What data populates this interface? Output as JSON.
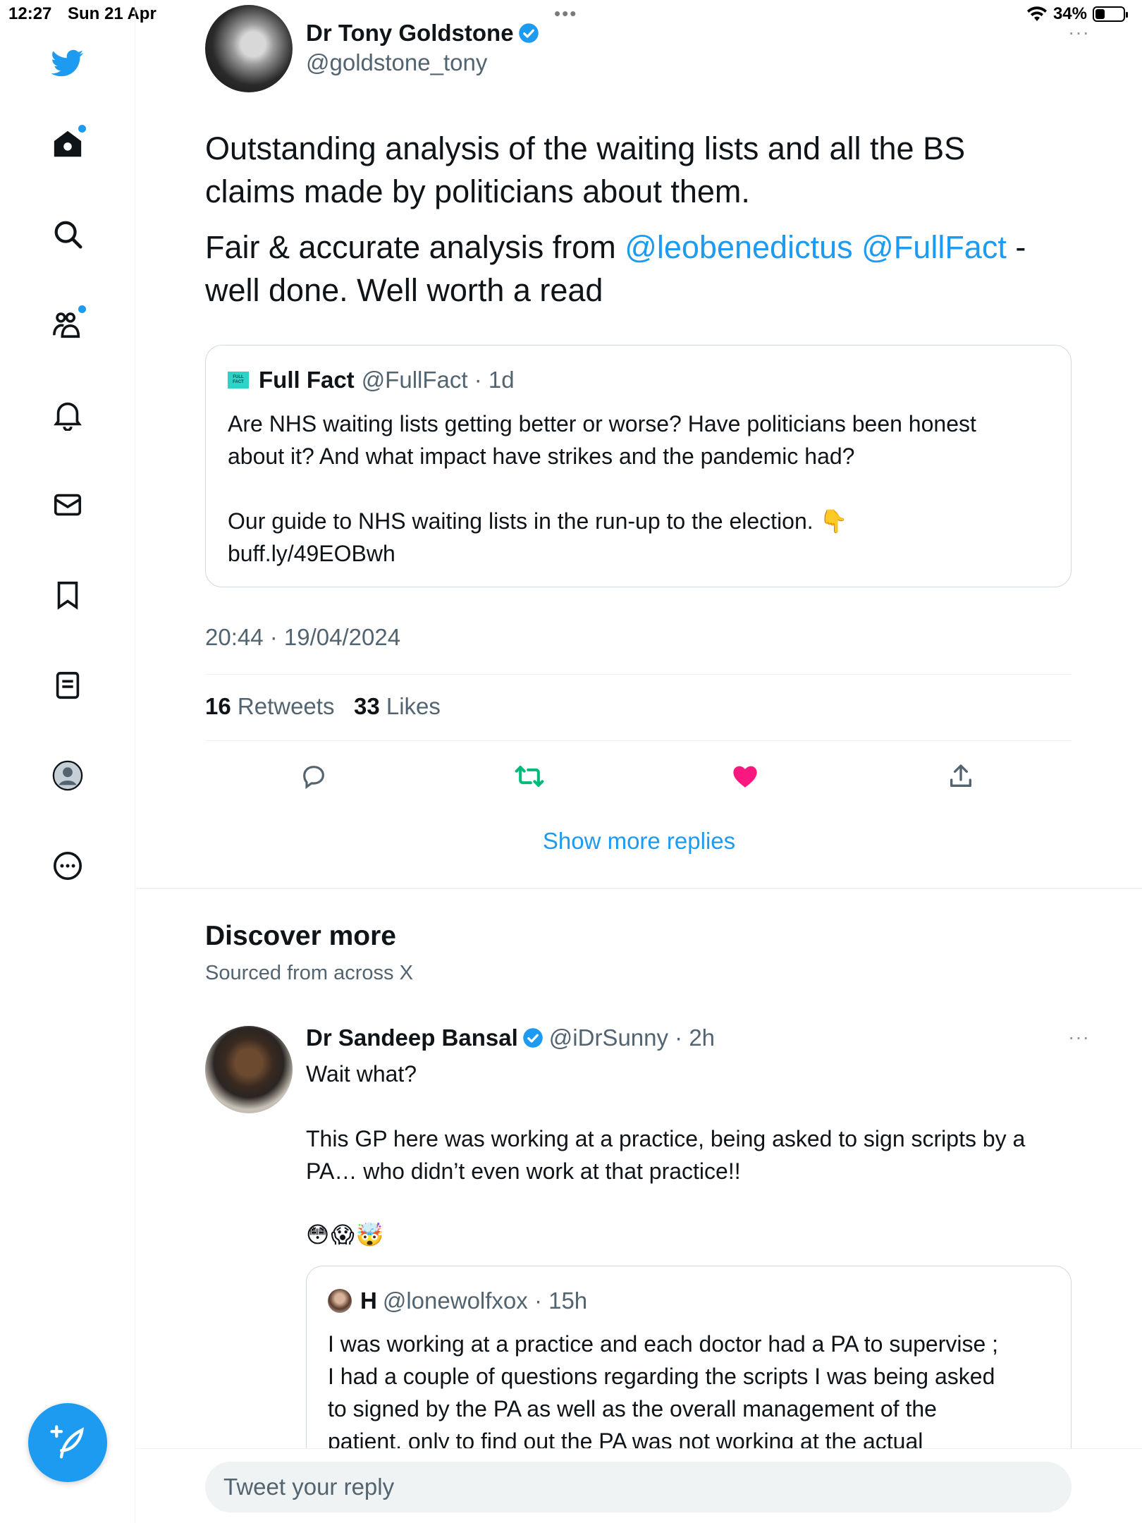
{
  "status_bar": {
    "time": "12:27",
    "date": "Sun 21 Apr",
    "battery": "34%",
    "battery_level": 0.34
  },
  "sidebar": {
    "items": [
      {
        "icon": "twitter-bird-icon"
      },
      {
        "icon": "home-icon",
        "notification_dot": true
      },
      {
        "icon": "search-icon"
      },
      {
        "icon": "communities-icon",
        "notification_dot": true
      },
      {
        "icon": "bell-icon"
      },
      {
        "icon": "mail-icon"
      },
      {
        "icon": "bookmark-icon"
      },
      {
        "icon": "list-icon"
      },
      {
        "icon": "profile-icon"
      },
      {
        "icon": "more-circle-icon"
      }
    ],
    "compose_icon": "compose-feather-icon"
  },
  "tweet": {
    "author_name": "Dr Tony Goldstone",
    "author_handle": "@goldstone_tony",
    "more": "···",
    "text_line1": "Outstanding analysis of the waiting lists and all the BS",
    "text_line2": "claims made by politicians about them.",
    "para2_prefix": "Fair & accurate analysis from ",
    "mention1": "@leobenedictus",
    "mention2": "@FullFact",
    "para2_suffix": " -",
    "para2_line2": "well done. Well worth a read",
    "quote": {
      "logo_text_1": "FULL",
      "logo_text_2": "FACT",
      "name": "Full Fact",
      "handle": "@FullFact · 1d",
      "line1": "Are NHS waiting lists getting better or worse? Have politicians been honest",
      "line2": "about it? And what impact have strikes and the pandemic had?",
      "line3": "Our guide to NHS waiting lists in the run-up to the election.  👇",
      "line4": "buff.ly/49EOBwh"
    },
    "timestamp": "20:44 · 19/04/2024",
    "retweets_count": "16",
    "retweets_label": "Retweets",
    "likes_count": "33",
    "likes_label": "Likes",
    "actions": [
      "reply-icon",
      "retweet-icon",
      "like-icon",
      "share-icon"
    ],
    "retweet_color": "#00ba7c",
    "like_color": "#f91880"
  },
  "show_more_replies": "Show more replies",
  "discover": {
    "title": "Discover more",
    "subtitle": "Sourced from across X"
  },
  "tweet2": {
    "author_name": "Dr Sandeep Bansal",
    "author_handle": "@iDrSunny · 2h",
    "more": "···",
    "line1": "Wait what?",
    "line2": "This GP here was working at a practice, being asked to sign scripts by a",
    "line3": "PA… who didn’t even work at that practice!!",
    "emojis": "😳😱🤯",
    "quote": {
      "name": "H",
      "handle": "@lonewolfxox · 15h",
      "line1": "I was working at a practice and each doctor had a PA to supervise ;",
      "line2": "I had a couple of questions regarding the scripts I was being asked",
      "line3": "to signed by the PA as well as the overall management of the",
      "line4": "patient, only to find out the PA was not working at the actual"
    }
  },
  "reply": {
    "placeholder": "Tweet your reply"
  },
  "colors": {
    "accent": "#1d9bf0",
    "text": "#0f1419",
    "secondary": "#536471",
    "border": "#cfd9de"
  }
}
